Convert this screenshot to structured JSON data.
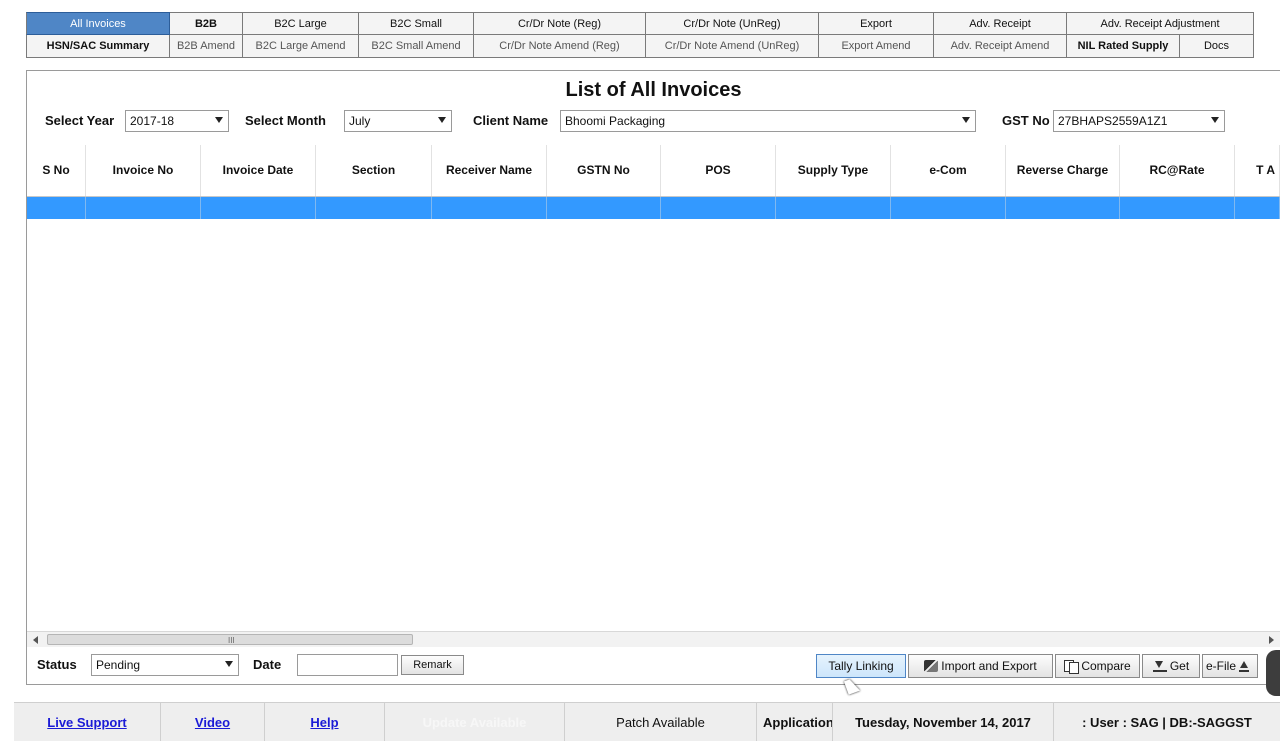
{
  "tabs": {
    "row1": [
      "All Invoices",
      "B2B",
      "B2C Large",
      "B2C Small",
      "Cr/Dr Note (Reg)",
      "Cr/Dr Note (UnReg)",
      "Export",
      "Adv. Receipt",
      "Adv. Receipt Adjustment"
    ],
    "row2": [
      "HSN/SAC Summary",
      "B2B Amend",
      "B2C Large Amend",
      "B2C Small Amend",
      "Cr/Dr Note Amend (Reg)",
      "Cr/Dr Note Amend (UnReg)",
      "Export Amend",
      "Adv. Receipt Amend",
      "NIL Rated Supply",
      "Docs"
    ]
  },
  "page_title": "List of All Invoices",
  "filters": {
    "year_label": "Select Year",
    "year_value": "2017-18",
    "month_label": "Select Month",
    "month_value": "July",
    "client_label": "Client Name",
    "client_value": "Bhoomi Packaging",
    "gst_label": "GST No",
    "gst_value": "27BHAPS2559A1Z1"
  },
  "grid": {
    "columns": [
      "S No",
      "Invoice No",
      "Invoice Date",
      "Section",
      "Receiver Name",
      "GSTN No",
      "POS",
      "Supply Type",
      "e-Com",
      "Reverse Charge",
      "RC@Rate",
      "T A"
    ],
    "selected_row": [
      "",
      "",
      "",
      "",
      "",
      "",
      "",
      "",
      "",
      "",
      "",
      ""
    ]
  },
  "scrollbar": {
    "grip": "III"
  },
  "bottom": {
    "status_label": "Status",
    "status_value": "Pending",
    "date_label": "Date",
    "date_value": "",
    "remark_label": "Remark",
    "tally_label": "Tally Linking",
    "import_label": "Import and Export",
    "compare_label": "Compare",
    "get_label": "Get",
    "efile_label": "e-File"
  },
  "statusbar": {
    "live_support": "Live Support",
    "video": "Video",
    "help": "Help",
    "update": "Update Available",
    "patch": "Patch Available",
    "application": "Application",
    "date": "Tuesday, November 14, 2017",
    "user": ": User : SAG | DB:-SAGGST"
  },
  "colors": {
    "active_tab": "#4f86c6",
    "selected_row": "#3399ff",
    "link": "#1a1ad6"
  }
}
